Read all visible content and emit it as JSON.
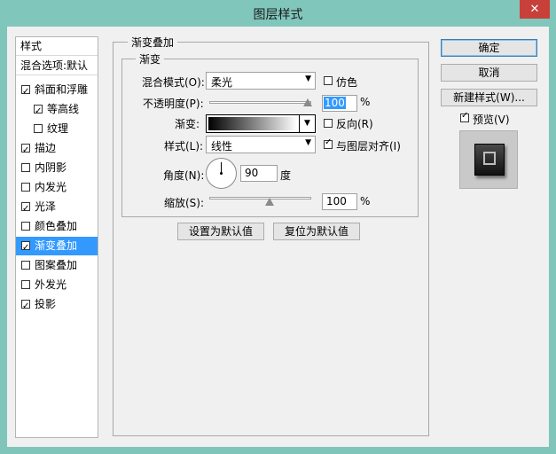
{
  "window": {
    "title": "图层样式",
    "close_glyph": "✕"
  },
  "sidebar": {
    "header": "样式",
    "blend_options": "混合选项:默认",
    "items": [
      {
        "label": "斜面和浮雕",
        "checked": true,
        "selected": false
      },
      {
        "label": "等高线",
        "checked": true,
        "selected": false
      },
      {
        "label": "纹理",
        "checked": false,
        "selected": false
      },
      {
        "label": "描边",
        "checked": true,
        "selected": false
      },
      {
        "label": "内阴影",
        "checked": false,
        "selected": false
      },
      {
        "label": "内发光",
        "checked": false,
        "selected": false
      },
      {
        "label": "光泽",
        "checked": true,
        "selected": false
      },
      {
        "label": "颜色叠加",
        "checked": false,
        "selected": false
      },
      {
        "label": "渐变叠加",
        "checked": true,
        "selected": true
      },
      {
        "label": "图案叠加",
        "checked": false,
        "selected": false
      },
      {
        "label": "外发光",
        "checked": false,
        "selected": false
      },
      {
        "label": "投影",
        "checked": true,
        "selected": false
      }
    ]
  },
  "main": {
    "group_title": "渐变叠加",
    "sub_title": "渐变",
    "blend_mode_label": "混合模式(O):",
    "blend_mode_value": "柔光",
    "dither_label": "仿色",
    "dither_checked": false,
    "opacity_label": "不透明度(P):",
    "opacity_value": "100",
    "opacity_unit": "%",
    "gradient_label": "渐变:",
    "reverse_label": "反向(R)",
    "reverse_checked": false,
    "style_label": "样式(L):",
    "style_value": "线性",
    "align_label": "与图层对齐(I)",
    "align_checked": true,
    "angle_label": "角度(N):",
    "angle_value": "90",
    "angle_unit": "度",
    "scale_label": "缩放(S):",
    "scale_value": "100",
    "scale_unit": "%",
    "make_default": "设置为默认值",
    "reset_default": "复位为默认值"
  },
  "right": {
    "ok": "确定",
    "cancel": "取消",
    "new_style": "新建样式(W)...",
    "preview_label": "预览(V)",
    "preview_checked": true
  }
}
